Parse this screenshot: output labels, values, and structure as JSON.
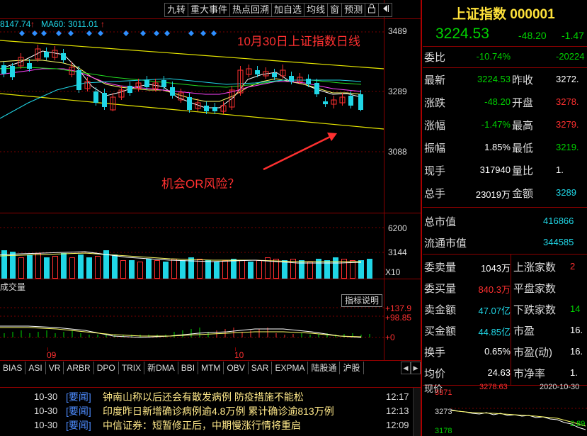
{
  "toolbar": {
    "items": [
      "九转",
      "重大事件",
      "热点回溯",
      "加自选",
      "均线",
      "窗",
      "预测"
    ]
  },
  "ma_bar": {
    "ma_partial": "8147.74",
    "ma60_label": "MA60: 3011.01",
    "ma60_arrow": "↑"
  },
  "chart": {
    "annotation_title": "10月30日上证指数日线",
    "annotation_question": "机会OR风险？",
    "price_ticks": [
      "3489",
      "3289",
      "3088"
    ],
    "volume_ticks": [
      "6200",
      "3144",
      "X10"
    ],
    "volume_label": "成交量",
    "indicator_button": "指标说明",
    "indicator_ticks": [
      "+137.9",
      "+98.85",
      "+0"
    ],
    "date_labels": [
      "09",
      "10"
    ]
  },
  "tabs": [
    "BIAS",
    "ASI",
    "VR",
    "ARBR",
    "DPO",
    "TRIX",
    "新DMA",
    "BBI",
    "MTM",
    "OBV",
    "SAR",
    "EXPMA",
    "陆股通",
    "沪股"
  ],
  "news": [
    {
      "date": "10-30",
      "tag": "[要闻]",
      "head": "钟南山称以后还会有散发病例 防疫措施不能松",
      "time": "12:17"
    },
    {
      "date": "10-30",
      "tag": "[要闻]",
      "head": "印度昨日新增确诊病例逾4.8万例 累计确诊逾813万例",
      "time": "12:13"
    },
    {
      "date": "10-30",
      "tag": "[要闻]",
      "head": "中信证券：短暂修正后，中期慢涨行情将重启",
      "time": "12:09"
    }
  ],
  "quote": {
    "title": "上证指数 000001",
    "price": "3224.53",
    "change": "-48.20",
    "change_pct": "-1.47",
    "rows": [
      {
        "l1": "委比",
        "v1": "-10.74%",
        "c1": "green",
        "l2": "",
        "v2": "-20224",
        "c2": "green"
      },
      {
        "l1": "最新",
        "v1": "3224.53",
        "c1": "green",
        "l2": "昨收",
        "v2": "3272.",
        "c2": "white"
      },
      {
        "l1": "涨跌",
        "v1": "-48.20",
        "c1": "green",
        "l2": "开盘",
        "v2": "3278.",
        "c2": "red"
      },
      {
        "l1": "涨幅",
        "v1": "-1.47%",
        "c1": "green",
        "l2": "最高",
        "v2": "3279.",
        "c2": "red"
      },
      {
        "l1": "振幅",
        "v1": "1.85%",
        "c1": "white",
        "l2": "最低",
        "v2": "3219.",
        "c2": "green"
      },
      {
        "l1": "现手",
        "v1": "317940",
        "c1": "white",
        "l2": "量比",
        "v2": "1.",
        "c2": "white"
      },
      {
        "l1": "总手",
        "v1": "23019万",
        "c1": "white",
        "l2": "金额",
        "v2": "3289",
        "c2": "cyan"
      }
    ],
    "total_mv_label": "总市值",
    "total_mv": "416866",
    "float_mv_label": "流通市值",
    "float_mv": "344585",
    "stats": [
      {
        "l1": "委卖量",
        "v1": "1043万",
        "c1": "white",
        "l2": "上涨家数",
        "v2": "2",
        "c2": "red"
      },
      {
        "l1": "委买量",
        "v1": "840.3万",
        "c1": "red",
        "l2": "平盘家数",
        "v2": "",
        "c2": "white"
      },
      {
        "l1": "卖金额",
        "v1": "47.07亿",
        "c1": "cyan",
        "l2": "下跌家数",
        "v2": "14",
        "c2": "green"
      },
      {
        "l1": "买金额",
        "v1": "44.85亿",
        "c1": "cyan",
        "l2": "市盈",
        "v2": "16.",
        "c2": "white"
      },
      {
        "l1": "换手",
        "v1": "0.65%",
        "c1": "white",
        "l2": "市盈(动)",
        "v2": "16.",
        "c2": "white"
      },
      {
        "l1": "均价",
        "v1": "24.63",
        "c1": "white",
        "l2": "市净率",
        "v2": "1.",
        "c2": "white"
      }
    ],
    "bottom_partial": "现价",
    "bottom_value": "3278.63",
    "bottom_date": "2020-10-30",
    "mini_ticks": [
      "3371",
      "3273",
      "3178"
    ],
    "mini_right": [
      "2.89",
      "2.89"
    ]
  }
}
